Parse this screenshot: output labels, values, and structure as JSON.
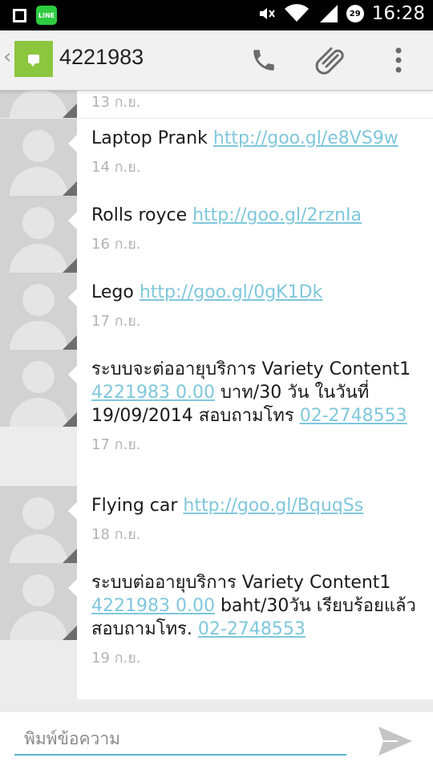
{
  "status_bar": {
    "time": "16:28",
    "line_app_label": "LINE",
    "notification_count": "29",
    "icons": [
      "stop-icon",
      "line-app-icon",
      "mute-icon",
      "wifi-icon",
      "signal-icon",
      "notification-badge"
    ]
  },
  "app_bar": {
    "contact": "4221983",
    "icons": [
      "back-chevron-icon",
      "messaging-app-icon",
      "phone-icon",
      "attachment-icon",
      "overflow-menu-icon"
    ]
  },
  "messages": [
    {
      "text_parts": [
        {
          "t": ""
        }
      ],
      "date": "13 ก.ย."
    },
    {
      "text_parts": [
        {
          "t": "Laptop Prank "
        },
        {
          "t": "http://goo.gl/e8VS9w",
          "link": true
        }
      ],
      "date": "14 ก.ย."
    },
    {
      "text_parts": [
        {
          "t": "Rolls royce "
        },
        {
          "t": "http://goo.gl/2rznIa",
          "link": true
        }
      ],
      "date": "16 ก.ย."
    },
    {
      "text_parts": [
        {
          "t": "Lego "
        },
        {
          "t": "http://goo.gl/0gK1Dk",
          "link": true
        }
      ],
      "date": "17 ก.ย."
    },
    {
      "text_parts": [
        {
          "t": "ระบบจะต่ออายุบริการ Variety Content1 "
        },
        {
          "t": "4221983 0.00",
          "link": true
        },
        {
          "t": " บาท/30 วัน ในวันที่ 19/09/2014 สอบถามโทร "
        },
        {
          "t": "02-2748553",
          "link": true
        }
      ],
      "date": "17 ก.ย."
    },
    {
      "text_parts": [
        {
          "t": "Flying car "
        },
        {
          "t": "http://goo.gl/BquqSs",
          "link": true
        }
      ],
      "date": "18 ก.ย."
    },
    {
      "text_parts": [
        {
          "t": "ระบบต่ออายุบริการ Variety Content1 "
        },
        {
          "t": "4221983 0.00",
          "link": true
        },
        {
          "t": " baht/30วัน เรียบร้อยแล้ว สอบถามโทร. "
        },
        {
          "t": "02-2748553",
          "link": true
        }
      ],
      "date": "19 ก.ย."
    }
  ],
  "compose": {
    "placeholder": "พิมพ์ข้อความ",
    "value": ""
  },
  "colors": {
    "link": "#7fc7dc",
    "accent": "#58b2cf",
    "app_icon": "#8cc63f"
  }
}
